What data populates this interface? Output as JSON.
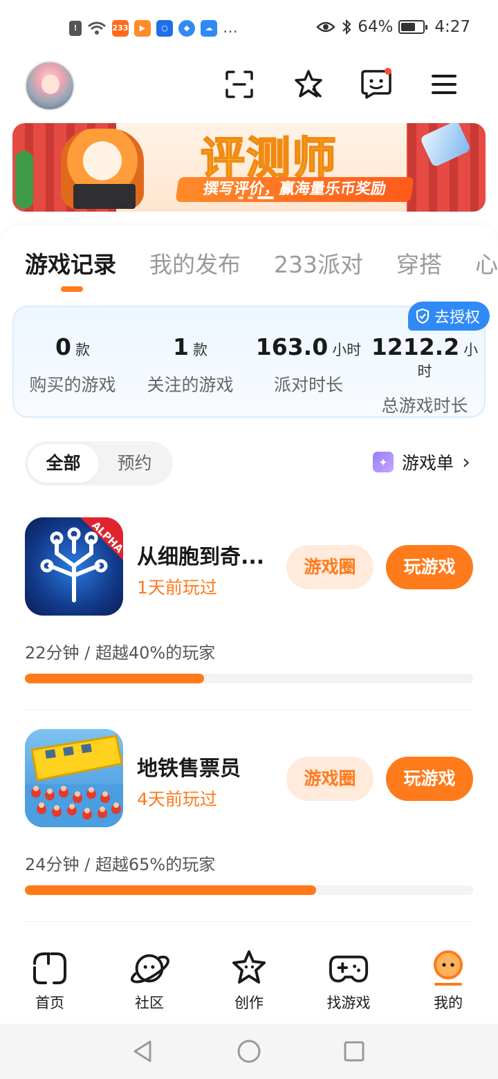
{
  "status_bar": {
    "battery_percent": "64%",
    "battery_level": 0.64,
    "time": "4:27",
    "notification_badge": "233",
    "more": "…"
  },
  "header": {
    "icons": [
      "scan-icon",
      "star-badge-icon",
      "message-icon",
      "menu-icon"
    ]
  },
  "banner": {
    "title": "评测师",
    "subtitle": "撰写评价，赢海量乐币奖励"
  },
  "tabs": [
    {
      "label": "游戏记录",
      "active": true
    },
    {
      "label": "我的发布",
      "active": false
    },
    {
      "label": "233派对",
      "active": false
    },
    {
      "label": "穿搭",
      "active": false
    },
    {
      "label": "心",
      "active": false
    }
  ],
  "stats": {
    "auth_badge": "去授权",
    "items": [
      {
        "value": "0",
        "unit": "款",
        "label": "购买的游戏"
      },
      {
        "value": "1",
        "unit": "款",
        "label": "关注的游戏"
      },
      {
        "value": "163.0",
        "unit": "小时",
        "label": "派对时长"
      },
      {
        "value": "1212.2",
        "unit": "小时",
        "label": "总游戏时长"
      }
    ]
  },
  "filter": {
    "segments": [
      {
        "label": "全部",
        "active": true
      },
      {
        "label": "预约",
        "active": false
      }
    ],
    "list_link": "游戏单",
    "chevron": "›"
  },
  "games": [
    {
      "title": "从细胞到奇...",
      "last_played": "1天前玩过",
      "circle_label": "游戏圈",
      "play_label": "玩游戏",
      "stat": "22分钟 / 超越40%的玩家",
      "progress": 0.4,
      "icon_badge": "ALPHA"
    },
    {
      "title": "地铁售票员",
      "last_played": "4天前玩过",
      "circle_label": "游戏圈",
      "play_label": "玩游戏",
      "stat": "24分钟 / 超越65%的玩家",
      "progress": 0.65
    }
  ],
  "bottom_nav": [
    {
      "label": "首页",
      "icon": "home-icon"
    },
    {
      "label": "社区",
      "icon": "planet-icon"
    },
    {
      "label": "创作",
      "icon": "create-star-icon"
    },
    {
      "label": "找游戏",
      "icon": "gamepad-icon"
    },
    {
      "label": "我的",
      "icon": "profile-icon",
      "active": true
    }
  ],
  "colors": {
    "accent": "#ff7a1a",
    "accent_light": "#ffeadb",
    "badge_blue": "#2f8af5"
  }
}
